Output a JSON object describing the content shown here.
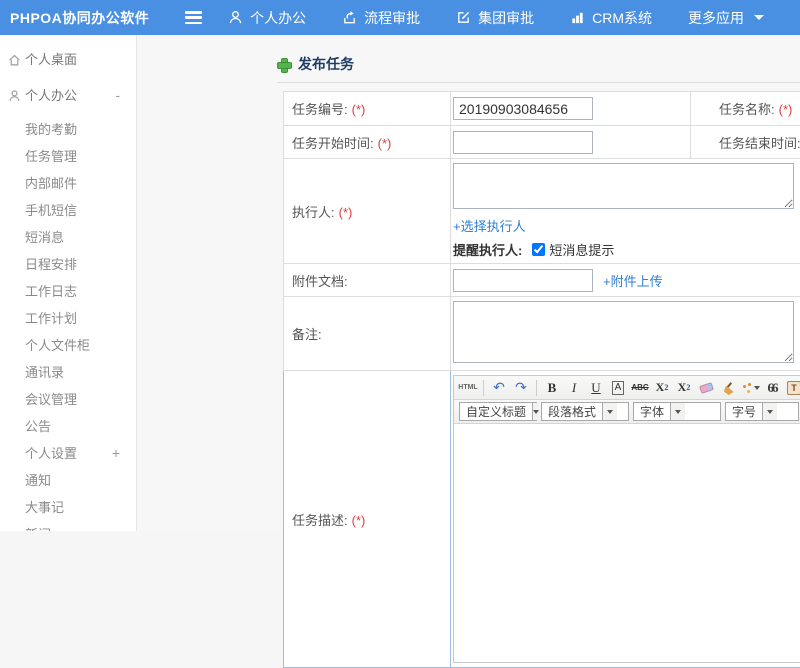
{
  "colors": {
    "header_bg": "#4a90e2",
    "link_blue": "#2d7fd0",
    "required_red": "#e23c3c",
    "title_color": "#1e3c66"
  },
  "header": {
    "brand": "PHPOA协同办公软件",
    "nav": [
      {
        "label": "个人办公"
      },
      {
        "label": "流程审批"
      },
      {
        "label": "集团审批"
      },
      {
        "label": "CRM系统"
      },
      {
        "label": "更多应用"
      }
    ]
  },
  "sidebar": {
    "items": [
      {
        "label": "个人桌面"
      },
      {
        "label": "个人办公",
        "toggle": "-"
      },
      {
        "label": "我的考勤"
      },
      {
        "label": "任务管理"
      },
      {
        "label": "内部邮件"
      },
      {
        "label": "手机短信"
      },
      {
        "label": "短消息"
      },
      {
        "label": "日程安排"
      },
      {
        "label": "工作日志"
      },
      {
        "label": "工作计划"
      },
      {
        "label": "个人文件柜"
      },
      {
        "label": "通讯录"
      },
      {
        "label": "会议管理"
      },
      {
        "label": "公告"
      },
      {
        "label": "个人设置",
        "toggle": "+"
      },
      {
        "label": "通知"
      },
      {
        "label": "大事记"
      },
      {
        "label": "新闻"
      }
    ]
  },
  "main": {
    "title": "发布任务",
    "form": {
      "required_mark": "(*)",
      "task_no_label": "任务编号:",
      "task_no_value": "20190903084656",
      "task_name_label": "任务名称:",
      "start_time_label": "任务开始时间:",
      "end_time_label": "任务结束时间:",
      "executor_label": "执行人:",
      "choose_executor_link": "+选择执行人",
      "remind_label": "提醒执行人:",
      "sms_tip_label": "短消息提示",
      "attachment_label": "附件文档:",
      "attachment_upload_link": "+附件上传",
      "remark_label": "备注:",
      "description_label": "任务描述:"
    },
    "editor": {
      "html_btn": "HTML",
      "undo": "↶",
      "redo": "↷",
      "bold": "B",
      "italic": "I",
      "underline": "U",
      "font_box": "A",
      "strike": "ABC",
      "sup_base": "X",
      "sup_exp": "2",
      "sub_base": "X",
      "sub_exp": "2",
      "quote": "66",
      "clipboard": "T",
      "color_a": "A",
      "selects": [
        {
          "label": "自定义标题"
        },
        {
          "label": "段落格式"
        },
        {
          "label": "字体"
        },
        {
          "label": "字号"
        }
      ]
    }
  }
}
